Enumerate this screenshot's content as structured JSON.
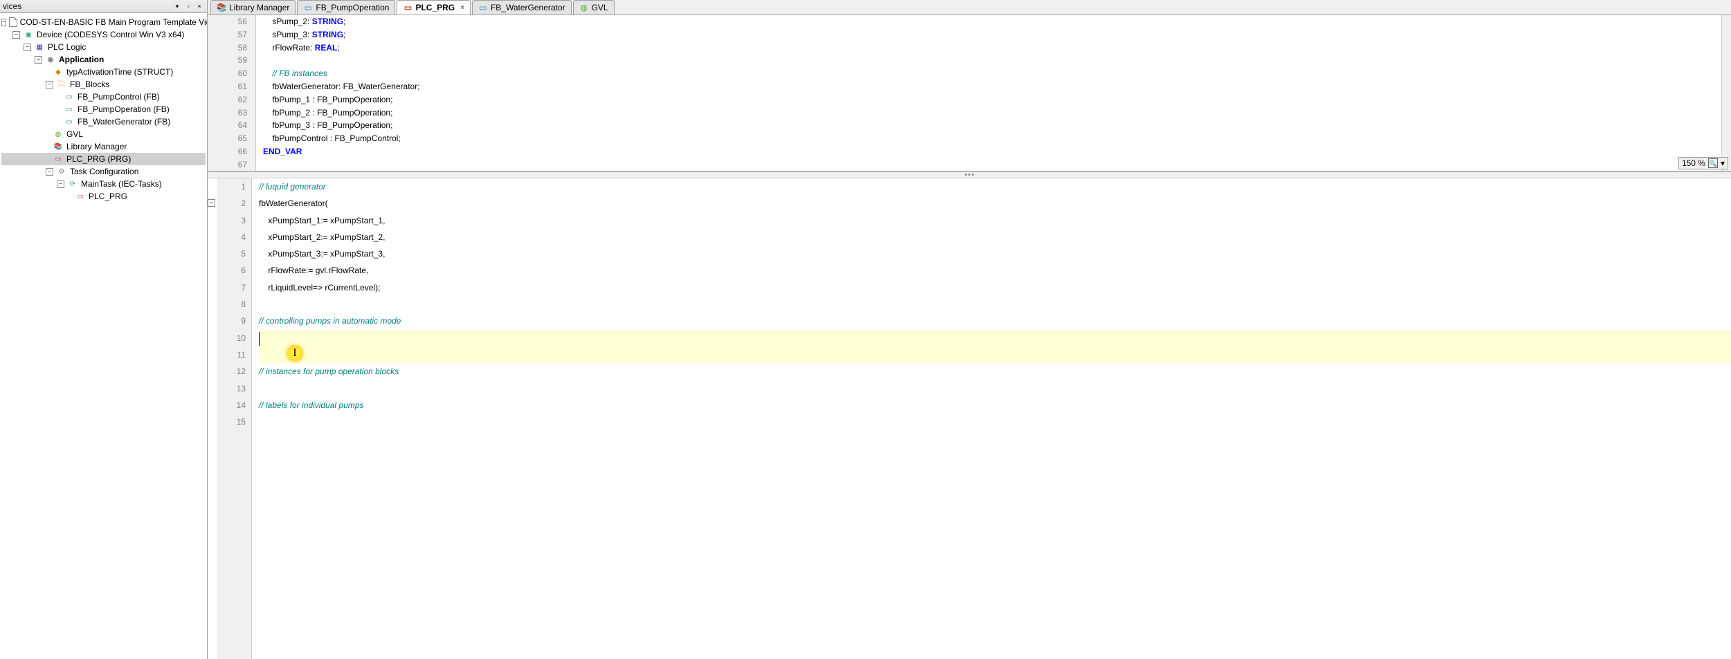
{
  "leftPanel": {
    "title": "vices"
  },
  "tree": {
    "root": "COD-ST-EN-BASIC FB Main Program Template Video",
    "device": "Device (CODESYS Control Win V3 x64)",
    "plcLogic": "PLC Logic",
    "application": "Application",
    "typActivation": "typActivationTime (STRUCT)",
    "fbBlocks": "FB_Blocks",
    "fbPumpControl": "FB_PumpControl (FB)",
    "fbPumpOperation": "FB_PumpOperation (FB)",
    "fbWaterGenerator": "FB_WaterGenerator (FB)",
    "gvl": "GVL",
    "libraryManager": "Library Manager",
    "plcPrg": "PLC_PRG (PRG)",
    "taskConfig": "Task Configuration",
    "mainTask": "MainTask (IEC-Tasks)",
    "plcPrgTask": "PLC_PRG"
  },
  "tabs": [
    {
      "label": "Library Manager",
      "active": false
    },
    {
      "label": "FB_PumpOperation",
      "active": false
    },
    {
      "label": "PLC_PRG",
      "active": true,
      "closable": true
    },
    {
      "label": "FB_WaterGenerator",
      "active": false
    },
    {
      "label": "GVL",
      "active": false
    }
  ],
  "zoom": "150 %",
  "topCode": {
    "startLine": 56,
    "lines": [
      {
        "n": 56,
        "segs": [
          {
            "t": "text",
            "v": "    sPump_2: "
          },
          {
            "t": "type",
            "v": "STRING"
          },
          {
            "t": "text",
            "v": ";"
          }
        ]
      },
      {
        "n": 57,
        "segs": [
          {
            "t": "text",
            "v": "    sPump_3: "
          },
          {
            "t": "type",
            "v": "STRING"
          },
          {
            "t": "text",
            "v": ";"
          }
        ]
      },
      {
        "n": 58,
        "segs": [
          {
            "t": "text",
            "v": "    rFlowRate: "
          },
          {
            "t": "type",
            "v": "REAL"
          },
          {
            "t": "text",
            "v": ";"
          }
        ]
      },
      {
        "n": 59,
        "segs": []
      },
      {
        "n": 60,
        "segs": [
          {
            "t": "comment",
            "v": "    // FB instances"
          }
        ]
      },
      {
        "n": 61,
        "segs": [
          {
            "t": "text",
            "v": "    fbWaterGenerator: FB_WaterGenerator;"
          }
        ]
      },
      {
        "n": 62,
        "segs": [
          {
            "t": "text",
            "v": "    fbPump_1 : FB_PumpOperation;"
          }
        ]
      },
      {
        "n": 63,
        "segs": [
          {
            "t": "text",
            "v": "    fbPump_2 : FB_PumpOperation;"
          }
        ]
      },
      {
        "n": 64,
        "segs": [
          {
            "t": "text",
            "v": "    fbPump_3 : FB_PumpOperation;"
          }
        ]
      },
      {
        "n": 65,
        "segs": [
          {
            "t": "text",
            "v": "    fbPumpControl : FB_PumpControl;"
          }
        ]
      },
      {
        "n": 66,
        "segs": [
          {
            "t": "keyword",
            "v": "END_VAR"
          }
        ]
      },
      {
        "n": 67,
        "segs": []
      }
    ]
  },
  "bottomCode": {
    "lines": [
      {
        "n": 1,
        "segs": [
          {
            "t": "comment",
            "v": "// luquid generator"
          }
        ]
      },
      {
        "n": 2,
        "segs": [
          {
            "t": "text",
            "v": "fbWaterGenerator("
          }
        ],
        "fold": true
      },
      {
        "n": 3,
        "segs": [
          {
            "t": "text",
            "v": "    xPumpStart_1:= xPumpStart_1,"
          }
        ]
      },
      {
        "n": 4,
        "segs": [
          {
            "t": "text",
            "v": "    xPumpStart_2:= xPumpStart_2,"
          }
        ]
      },
      {
        "n": 5,
        "segs": [
          {
            "t": "text",
            "v": "    xPumpStart_3:= xPumpStart_3,"
          }
        ]
      },
      {
        "n": 6,
        "segs": [
          {
            "t": "text",
            "v": "    rFlowRate:= gvl.rFlowRate,"
          }
        ]
      },
      {
        "n": 7,
        "segs": [
          {
            "t": "text",
            "v": "    rLiquidLevel=> rCurrentLevel);"
          }
        ]
      },
      {
        "n": 8,
        "segs": []
      },
      {
        "n": 9,
        "segs": [
          {
            "t": "comment",
            "v": "// controlling pumps in automatic mode"
          }
        ]
      },
      {
        "n": 10,
        "segs": [],
        "highlight": true,
        "caret": true
      },
      {
        "n": 11,
        "segs": [],
        "highlight": true,
        "cursorMarker": true
      },
      {
        "n": 12,
        "segs": [
          {
            "t": "comment",
            "v": "// instances for pump operation blocks"
          }
        ]
      },
      {
        "n": 13,
        "segs": []
      },
      {
        "n": 14,
        "segs": [
          {
            "t": "comment",
            "v": "// labels for individual pumps"
          }
        ]
      },
      {
        "n": 15,
        "segs": []
      }
    ]
  },
  "cursorMarkerGlyph": "I"
}
